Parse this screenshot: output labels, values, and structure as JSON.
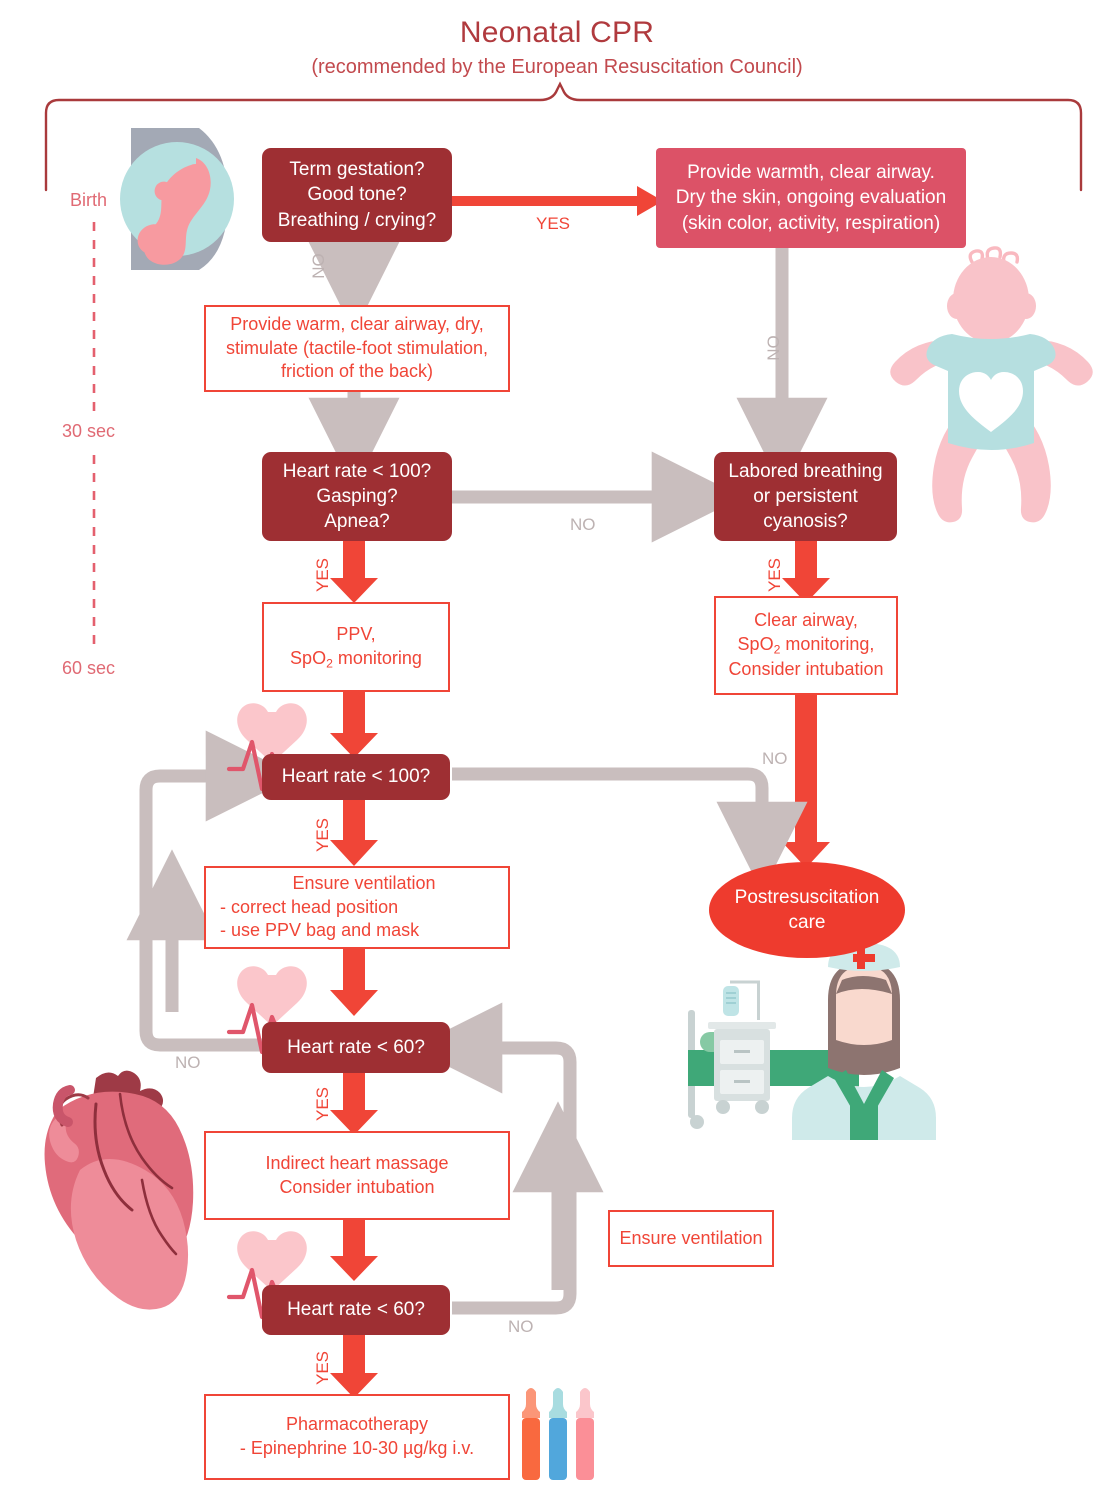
{
  "title": {
    "main": "Neonatal CPR",
    "subtitle": "(recommended by the European Resuscitation Council)"
  },
  "timeline": {
    "labels": [
      "Birth",
      "30 sec",
      "60 sec"
    ]
  },
  "colors": {
    "decision_box": "#9E2F33",
    "action_box_fill": "#DC5267",
    "outline_box_border": "#F04537",
    "outline_box_text": "#F04537",
    "terminal_ellipse": "#EE3B2E",
    "yes_arrow": "#F04537",
    "no_arrow": "#C9BEBE",
    "title_text": "#B03A3E",
    "timeline_text": "#E06A74"
  },
  "nodes": {
    "initial_assessment": {
      "type": "decision",
      "lines": [
        "Term gestation?",
        "Good tone?",
        "Breathing / crying?"
      ]
    },
    "routine_care": {
      "type": "action_filled",
      "lines": [
        "Provide warmth, clear airway.",
        "Dry the skin, ongoing evaluation",
        "(skin color, activity, respiration)"
      ]
    },
    "initial_steps": {
      "type": "action_outline",
      "lines": [
        "Provide warm, clear airway, dry,",
        "stimulate (tactile-foot stimulation,",
        "friction of the back)"
      ]
    },
    "hr100_gasping": {
      "type": "decision",
      "lines": [
        "Heart rate < 100?",
        "Gasping?",
        "Apnea?"
      ]
    },
    "labored_breathing": {
      "type": "decision",
      "lines": [
        "Labored breathing",
        "or persistent",
        "cyanosis?"
      ]
    },
    "ppv_spo2": {
      "type": "action_outline",
      "lines": [
        "PPV,",
        "SpO2 monitoring"
      ],
      "line2_prefix": "SpO",
      "line2_sub": "2",
      "line2_suffix": " monitoring"
    },
    "clear_airway_spo2": {
      "type": "action_outline",
      "lines": [
        "Clear airway,",
        "SpO2 monitoring,",
        "Consider intubation"
      ],
      "line2_prefix": "SpO",
      "line2_sub": "2",
      "line2_suffix": " monitoring,"
    },
    "hr100_check": {
      "type": "decision",
      "lines": [
        "Heart rate < 100?"
      ]
    },
    "ensure_ventilation_detail": {
      "type": "action_outline",
      "lines": [
        "Ensure ventilation",
        "- correct head position",
        "- use PPV bag and mask"
      ]
    },
    "hr60_check_1": {
      "type": "decision",
      "lines": [
        "Heart rate < 60?"
      ]
    },
    "heart_massage": {
      "type": "action_outline",
      "lines": [
        "Indirect heart massage",
        "Consider intubation"
      ]
    },
    "hr60_check_2": {
      "type": "decision",
      "lines": [
        "Heart rate < 60?"
      ]
    },
    "pharmacotherapy": {
      "type": "action_outline",
      "lines": [
        "Pharmacotherapy",
        "- Epinephrine 10-30 µg/kg i.v."
      ]
    },
    "ensure_ventilation_note": {
      "type": "action_outline",
      "lines": [
        "Ensure ventilation"
      ]
    },
    "postresuscitation": {
      "type": "terminal",
      "lines": [
        "Postresuscitation",
        "care"
      ]
    }
  },
  "edge_labels": {
    "yes_to_routine_care": "YES",
    "no_to_initial_steps": "NO",
    "no_routine_to_labored": "NO",
    "yes_hr100gasping_to_ppv": "YES",
    "no_hr100gasping_to_labored": "NO",
    "yes_labored_to_clearairway": "YES",
    "no_hr100check_to_post": "NO",
    "yes_hr100check_to_ventilation": "YES",
    "no_hr60_1_loopback": "NO",
    "yes_hr60_1_to_massage": "YES",
    "no_hr60_2_loopback": "NO",
    "yes_hr60_2_to_pharma": "YES"
  },
  "illustrations": {
    "fetus_in_womb": "fetus-in-womb-illustration",
    "baby": "baby-illustration",
    "nurse_hospital": "nurse-hospital-illustration",
    "anatomical_heart": "anatomical-heart-illustration",
    "ampoules": "ampoules-illustration",
    "heart_pulse_badges": "heart-pulse-icon"
  }
}
